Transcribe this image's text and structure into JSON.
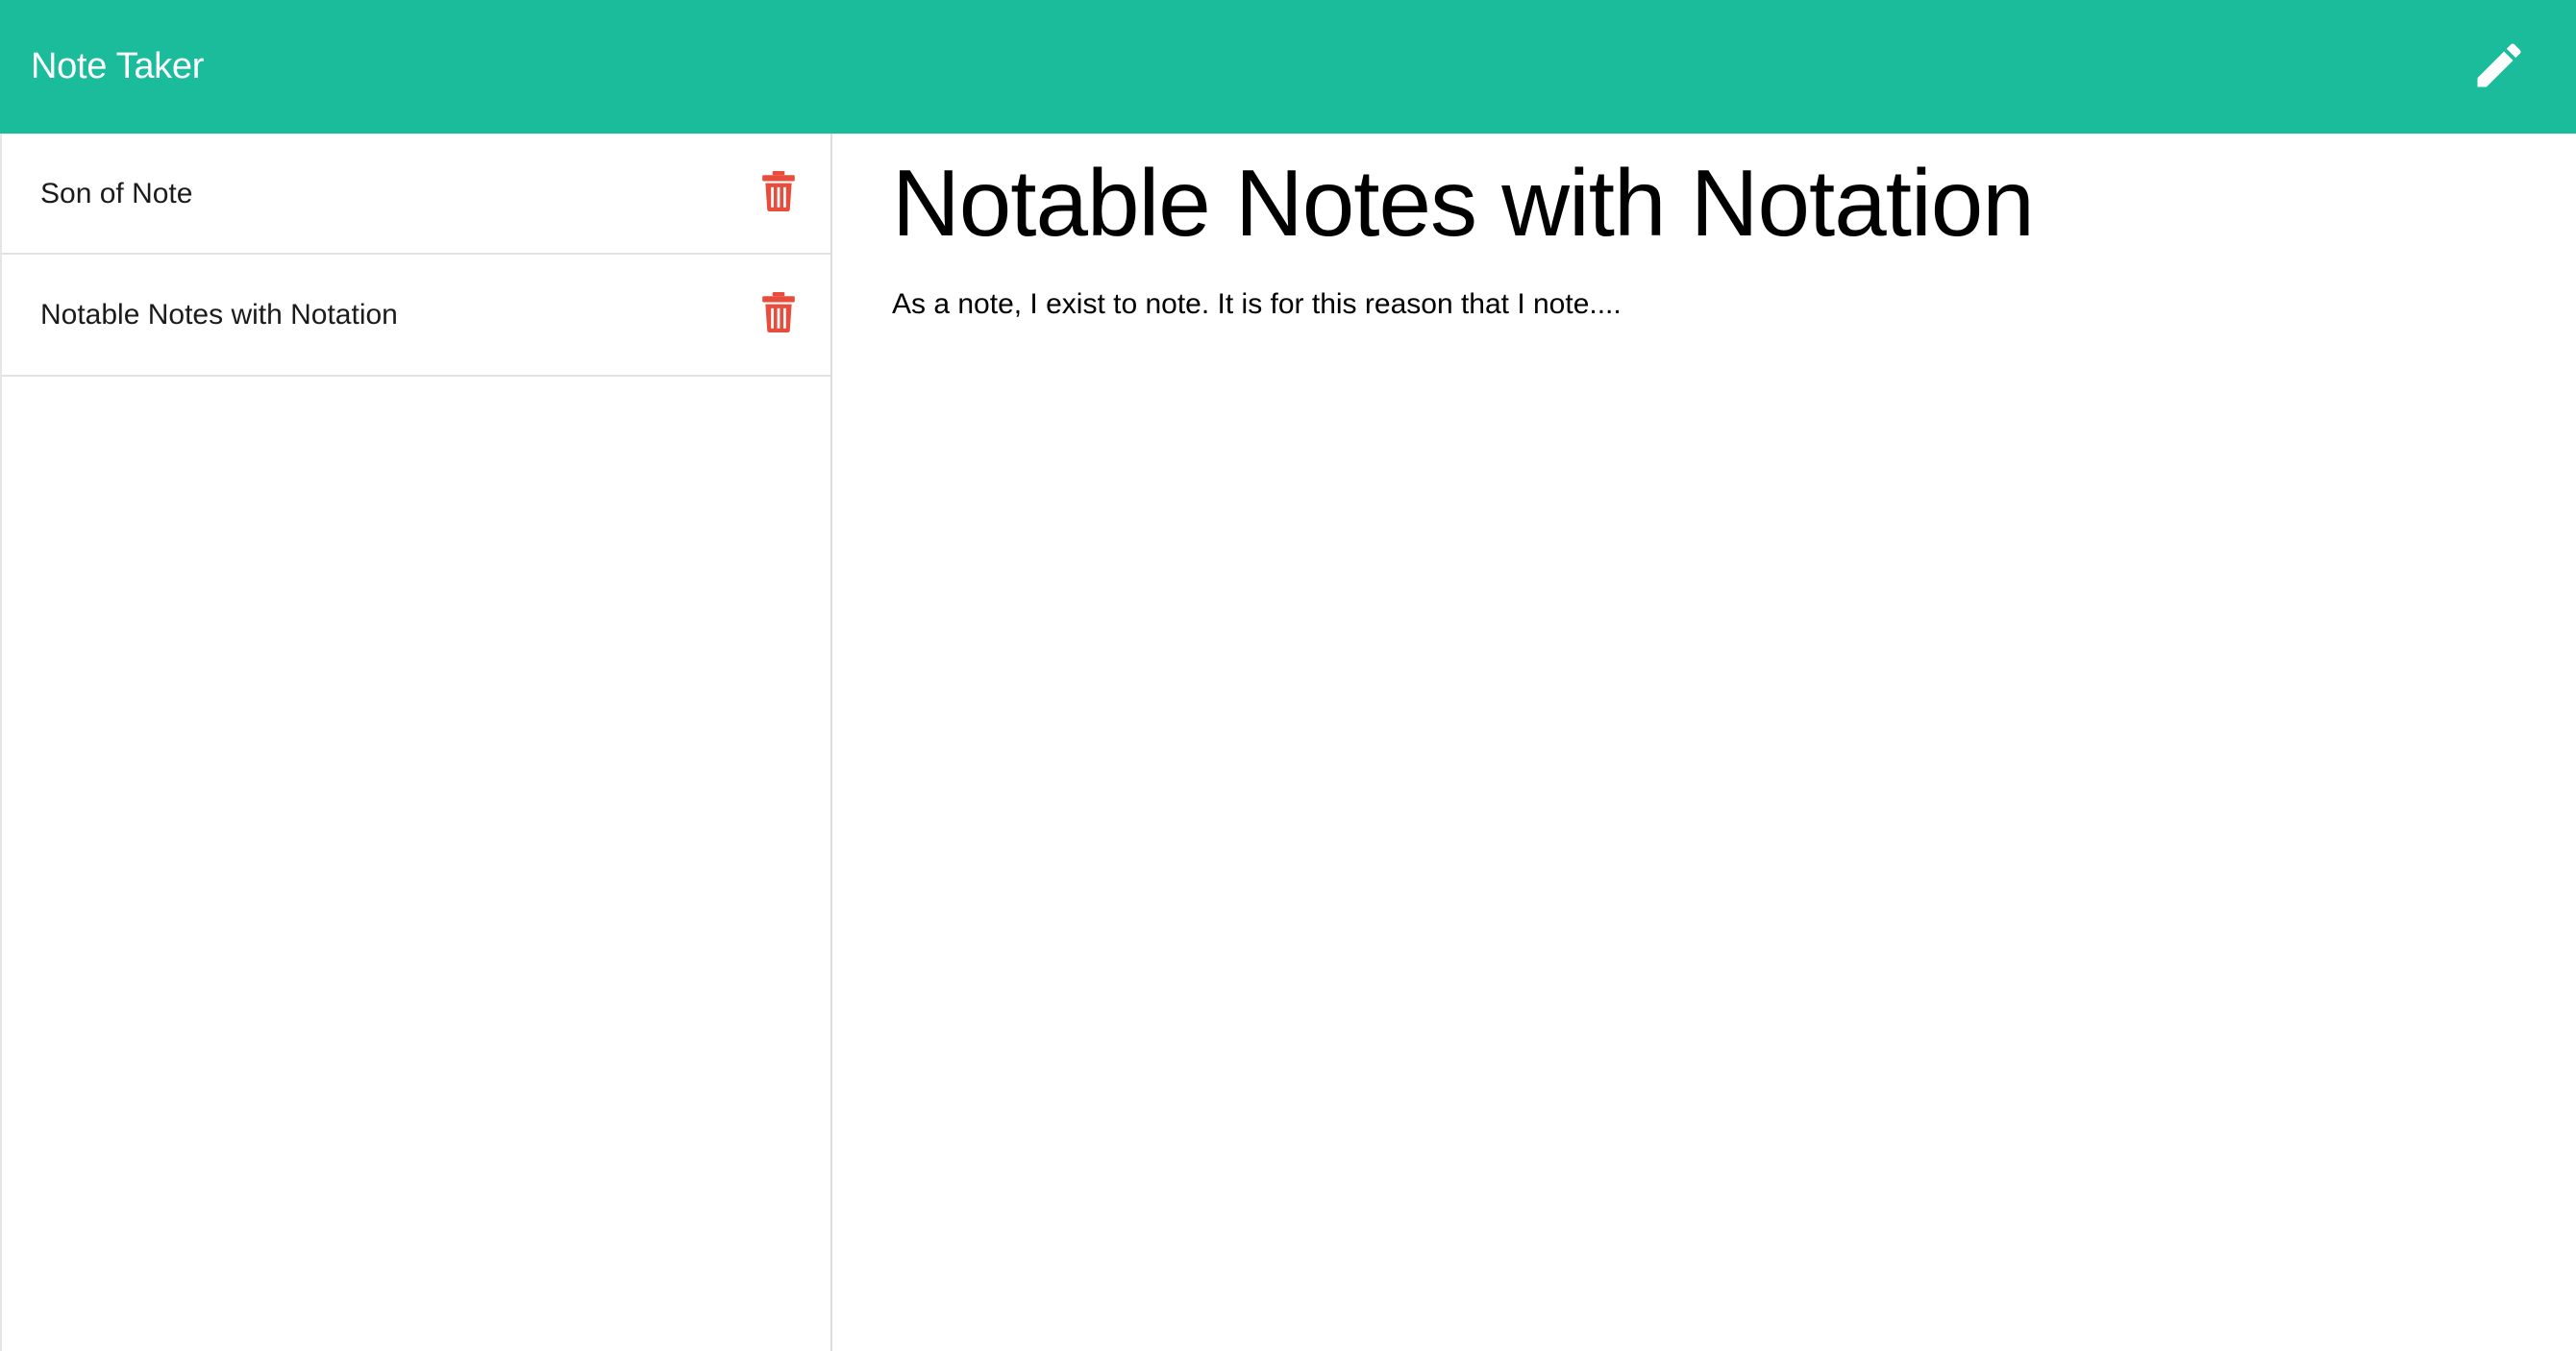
{
  "app": {
    "title": "Note Taker",
    "accent_color": "#1abc9c",
    "new_note_icon": "pencil-icon"
  },
  "sidebar": {
    "notes": [
      {
        "title": "Son of Note",
        "delete_icon": "trash-icon"
      },
      {
        "title": "Notable Notes with Notation",
        "delete_icon": "trash-icon"
      }
    ],
    "delete_color": "#e74c3c"
  },
  "main": {
    "note_title": "Notable Notes with Notation",
    "note_text": "As a note, I exist to note. It is for this reason that I note...."
  }
}
